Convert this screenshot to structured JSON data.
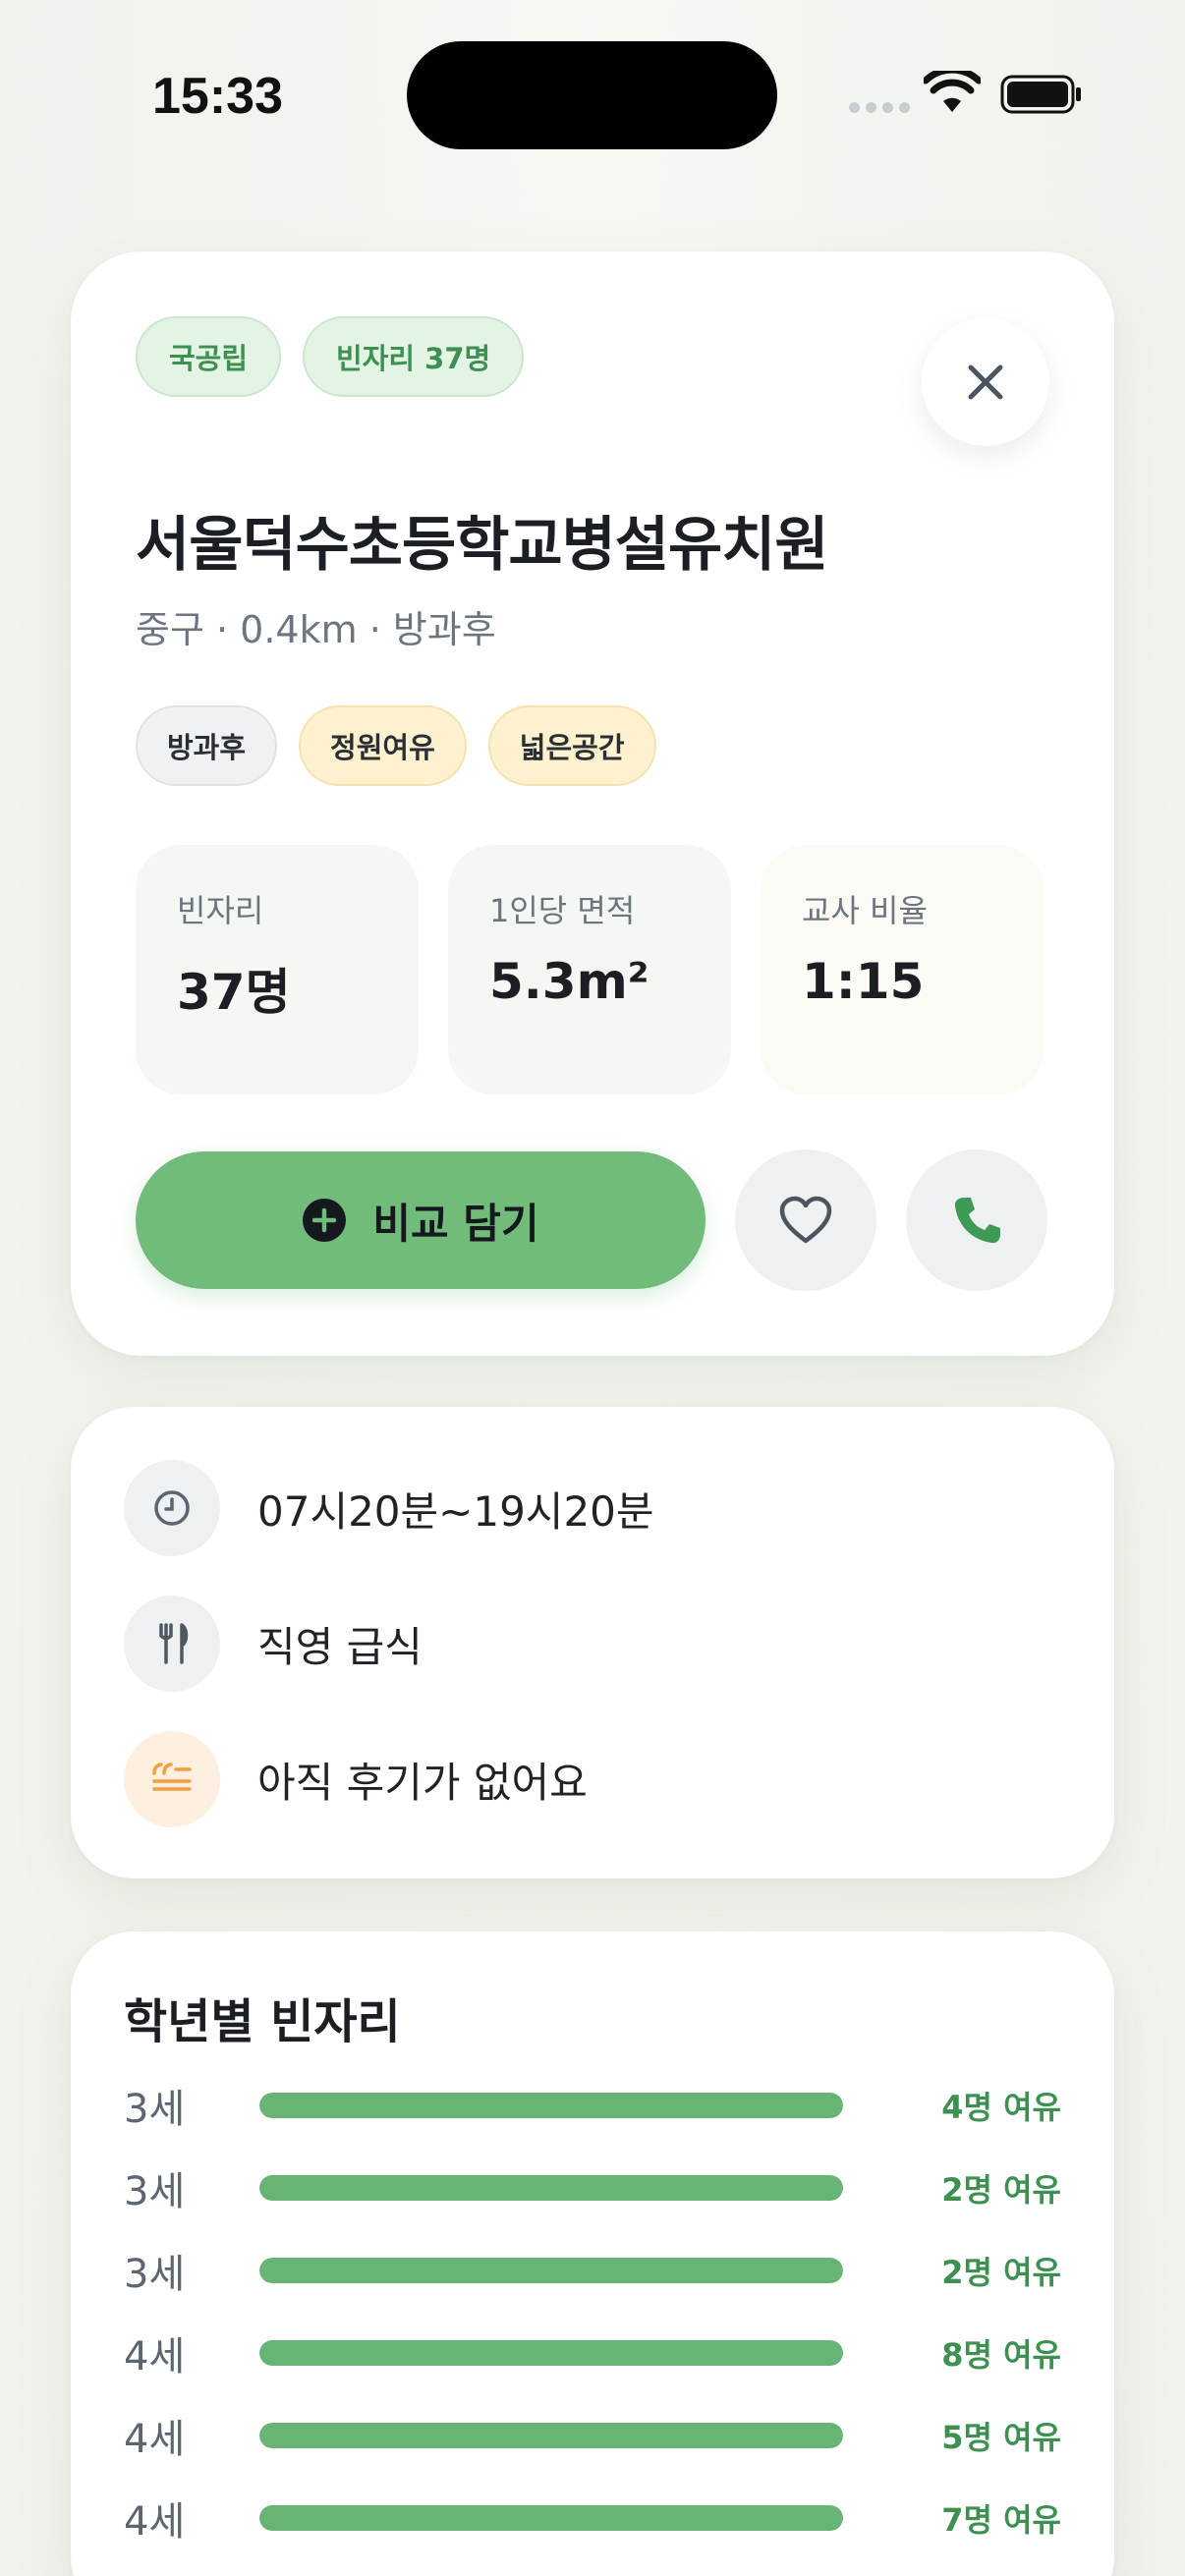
{
  "status_bar": {
    "time": "15:33"
  },
  "detail": {
    "tags": [
      "국공립",
      "빈자리 37명"
    ],
    "title": "서울덕수초등학교병설유치원",
    "subtitle": "중구 · 0.4km · 방과후",
    "chips": [
      {
        "label": "방과후",
        "style": "gray"
      },
      {
        "label": "정원여유",
        "style": "yellow"
      },
      {
        "label": "넓은공간",
        "style": "yellow"
      }
    ],
    "stats": [
      {
        "label": "빈자리",
        "value": "37명"
      },
      {
        "label": "1인당 면적",
        "value": "5.3m²"
      },
      {
        "label": "교사 비율",
        "value": "1:15"
      }
    ],
    "compare_label": "비교 담기"
  },
  "info": {
    "hours": "07시20분~19시20분",
    "meal": "직영 급식",
    "reviews": "아직 후기가 없어요"
  },
  "grades": {
    "title": "학년별 빈자리",
    "rows": [
      {
        "age": "3세",
        "status": "4명 여유",
        "fill": 1.0
      },
      {
        "age": "3세",
        "status": "2명 여유",
        "fill": 1.0
      },
      {
        "age": "3세",
        "status": "2명 여유",
        "fill": 1.0
      },
      {
        "age": "4세",
        "status": "8명 여유",
        "fill": 1.0
      },
      {
        "age": "4세",
        "status": "5명 여유",
        "fill": 1.0
      },
      {
        "age": "4세",
        "status": "7명 여유",
        "fill": 1.0
      }
    ]
  },
  "colors": {
    "accent_green": "#71bb7b",
    "status_green": "#3e8f52",
    "bar_green": "#67b474"
  },
  "icons": {
    "close": "close-icon",
    "compare": "plus-circle-icon",
    "favorite": "heart-icon",
    "call": "phone-icon",
    "hours": "clock-icon",
    "meal": "fork-knife-icon",
    "reviews": "quote-icon"
  }
}
